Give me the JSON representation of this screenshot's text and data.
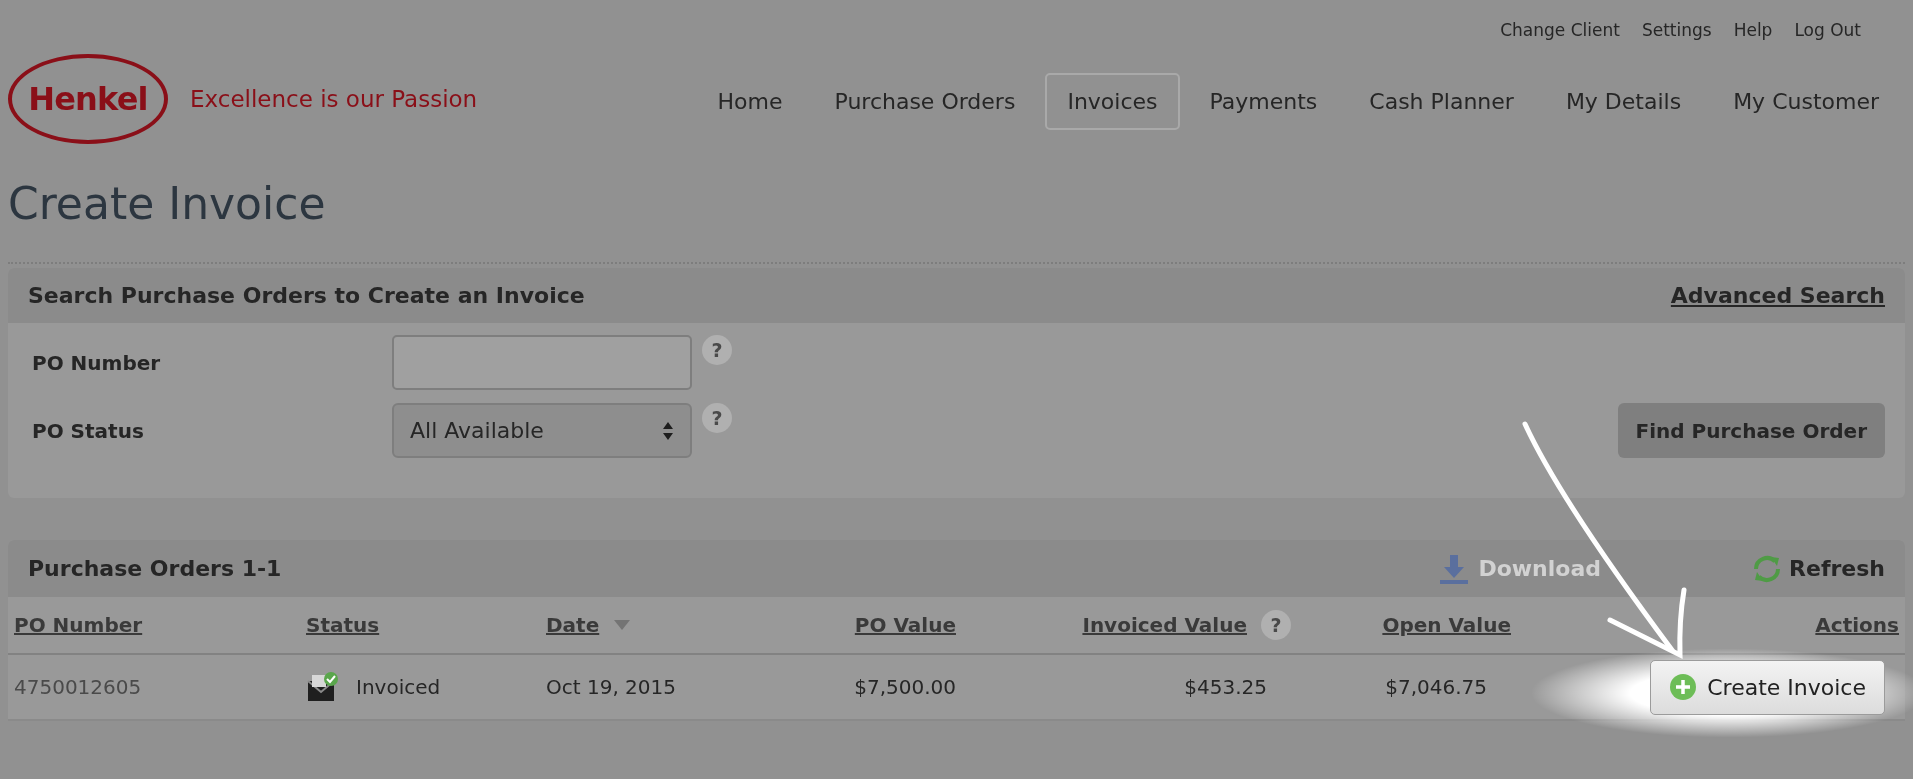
{
  "top_links": [
    "Change Client",
    "Settings",
    "Help",
    "Log Out"
  ],
  "logo": {
    "brand": "Henkel",
    "tagline": "Excellence is our Passion"
  },
  "nav": [
    {
      "label": "Home",
      "selected": false
    },
    {
      "label": "Purchase Orders",
      "selected": false
    },
    {
      "label": "Invoices",
      "selected": true
    },
    {
      "label": "Payments",
      "selected": false
    },
    {
      "label": "Cash Planner",
      "selected": false
    },
    {
      "label": "My Details",
      "selected": false
    },
    {
      "label": "My Customer",
      "selected": false
    }
  ],
  "page_title": "Create Invoice",
  "search_panel": {
    "title": "Search Purchase Orders to Create an Invoice",
    "advanced_search": "Advanced Search",
    "fields": [
      {
        "label": "PO Number",
        "kind": "text",
        "help": "?"
      },
      {
        "label": "PO Status",
        "kind": "select",
        "value": "All Available",
        "help": "?"
      }
    ],
    "button": "Find Purchase Order"
  },
  "results": {
    "title": "Purchase Orders 1-1",
    "download": {
      "label": "Download",
      "disabled": true
    },
    "refresh": "Refresh",
    "columns": [
      {
        "label": "PO Number"
      },
      {
        "label": "Status"
      },
      {
        "label": "Date",
        "sorted": true
      },
      {
        "label": "PO Value"
      },
      {
        "label": "Invoiced Value",
        "help": "?"
      },
      {
        "label": "Open Value"
      },
      {
        "label": "Actions"
      }
    ],
    "rows": [
      {
        "po_number": "4750012605",
        "status": "Invoiced",
        "date": "Oct 19, 2015",
        "po_value": "$7,500.00",
        "invoiced_value": "$453.25",
        "open_value": "$7,046.75",
        "action": "Create Invoice"
      }
    ]
  }
}
